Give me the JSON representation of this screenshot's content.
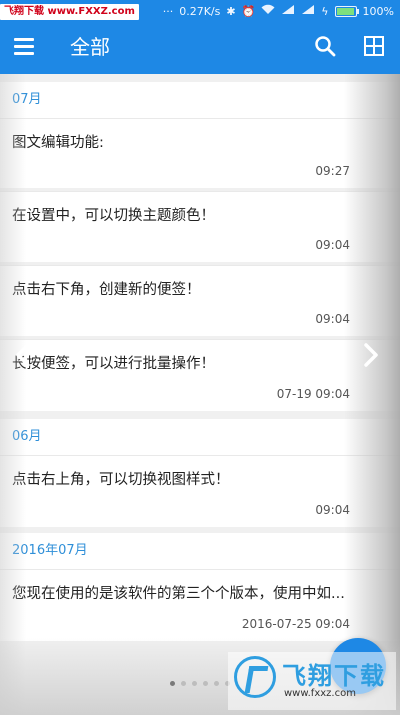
{
  "status_bar": {
    "watermark_label": "飞翔下载",
    "watermark_url": "www.FXXZ.com",
    "network_speed": "0.27K/s",
    "battery": "100%",
    "colors": {
      "bar": "#1e88e5"
    }
  },
  "appbar": {
    "title": "全部",
    "icons": [
      "menu-icon",
      "search-icon",
      "grid-view-icon"
    ]
  },
  "sections": [
    {
      "header": "07月",
      "notes": [
        {
          "text": "图文编辑功能:",
          "time": "09:27"
        },
        {
          "text": "在设置中，可以切换主题颜色！",
          "time": "09:04"
        },
        {
          "text": "点击右下角，创建新的便签！",
          "time": "09:04"
        },
        {
          "text": "长按便签，可以进行批量操作！",
          "time": "07-19 09:04"
        }
      ]
    },
    {
      "header": "06月",
      "notes": [
        {
          "text": "点击右上角，可以切换视图样式！",
          "time": "09:04"
        }
      ]
    },
    {
      "header": "2016年07月",
      "notes": [
        {
          "text": "您现在使用的是该软件的第三个个版本，使用中如...",
          "time": "2016-07-25 09:04"
        }
      ]
    }
  ],
  "watermark_logo": {
    "brand": "飞翔下载",
    "url": "www.fxxz.com"
  },
  "pager": {
    "total": 6,
    "active": 1
  },
  "accent_color": "#1e88e5"
}
